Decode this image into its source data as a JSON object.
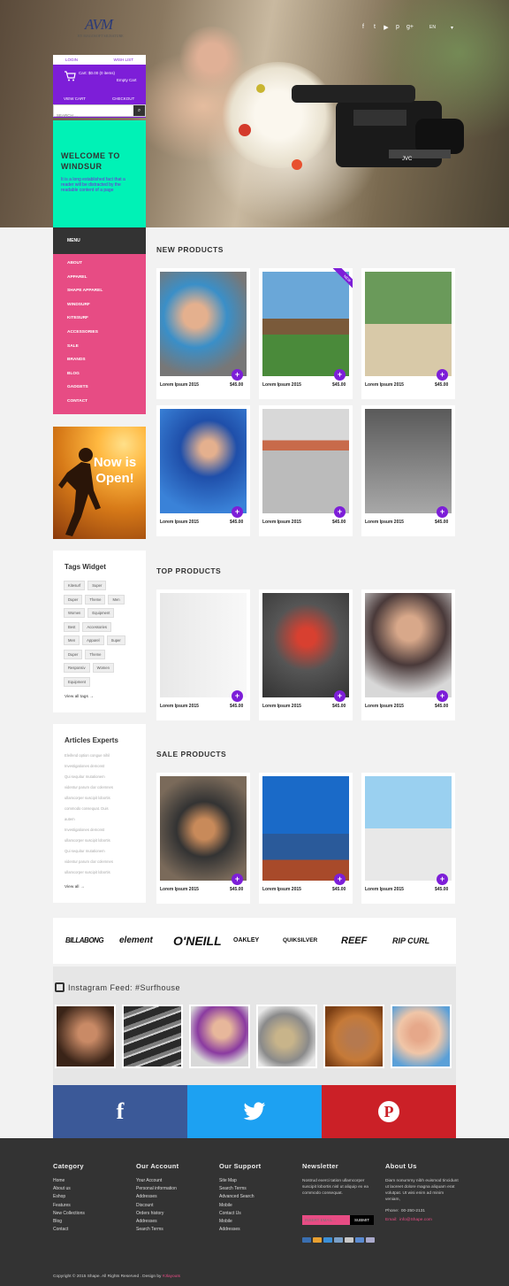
{
  "header": {
    "logo_text": "AVM",
    "logo_sub": "BY MAGOSOFT SIGNATURE",
    "social_icons": [
      "facebook-icon",
      "twitter-icon",
      "youtube-icon",
      "pinterest-icon",
      "google-plus-icon"
    ],
    "social_glyphs": [
      "f",
      "t",
      "▶",
      "p",
      "g+"
    ],
    "language": "EN"
  },
  "account": {
    "login": "LOGIN",
    "wishlist": "WISH LIST",
    "cart_line1": "Cart: $0.00 (0 items)",
    "cart_line2": "Empty Cart",
    "view_cart": "VIEW CART",
    "checkout": "CHECKOUT"
  },
  "search": {
    "placeholder": "SEARCH ..."
  },
  "welcome": {
    "title": "WELCOME TO WINDSUR",
    "text": "It is a long established fact that a reader will be distracted by the readable content of a page"
  },
  "menu": {
    "heading": "MENU",
    "items": [
      "ABOUT",
      "APPAREL",
      "SHAPE APPAREL",
      "WINDSURF",
      "KITESURF",
      "ACCESSORIES",
      "SALE",
      "BRANDS",
      "BLOG",
      "GADGETS",
      "CONTACT"
    ]
  },
  "promo": {
    "text": "Now is Open!"
  },
  "tags_widget": {
    "title": "Tags Widget",
    "rows": [
      [
        "Kitesurf",
        "Super"
      ],
      [
        "Duper",
        "Theme",
        "Men"
      ],
      [
        "Women",
        "Equipment"
      ],
      [
        "Best",
        "Accessories"
      ],
      [
        "Men",
        "Apparel",
        "Super"
      ],
      [
        "Duper",
        "Theme"
      ],
      [
        "Responsiv",
        "Women"
      ],
      [
        "Equipment"
      ]
    ],
    "view_all": "View all tags →"
  },
  "articles_widget": {
    "title": "Articles Experts",
    "lines": [
      "Eleifend option congue nihil",
      "Investigationes demonst",
      "Qui sequitur mutationem",
      "videntur parum clar colemnes",
      "ullamcorper suscipit lobortis",
      "commodo consequat. Duis",
      "autem",
      "Investigationes demonst",
      "ullamcorper suscipit lobortis",
      "Qui sequitur mutationem",
      "videntur parum clar colemnes",
      "ullamcorper suscipit lobortis"
    ],
    "view_all": "View all →"
  },
  "sections": {
    "new": "NEW PRODUCTS",
    "top": "TOP PRODUCTS",
    "sale": "SALE PRODUCTS"
  },
  "product": {
    "name": "Lorem Ipsum 2015",
    "price": "$45.00",
    "badge": "NEW"
  },
  "brands": [
    "BILLABONG",
    "element",
    "O'NEILL",
    "OAKLEY",
    "QUIKSILVER",
    "REEF",
    "RIP CURL"
  ],
  "instagram": {
    "title": "Instagram Feed: #Surfhouse"
  },
  "social_banners": [
    "f",
    "twitter",
    "P"
  ],
  "footer": {
    "category": {
      "title": "Category",
      "links": [
        "Home",
        "About us",
        "Eshop",
        "Features",
        "New Collections",
        "Blog",
        "Contact"
      ]
    },
    "account": {
      "title": "Our Account",
      "links": [
        "Your Account",
        "Personal information",
        "Addresses",
        "Discount",
        "Orders history",
        "Addresses",
        "Search Terms"
      ]
    },
    "support": {
      "title": "Our Support",
      "links": [
        "Site Map",
        "Search Terms",
        "Advanced Search",
        "Mobile",
        "Contact Us",
        "Mobile",
        "Addresses"
      ]
    },
    "newsletter": {
      "title": "Newsletter",
      "text": "Nostrud exerci tation ullamcorper suscipit lobortis nisl ut aliquip ex ea commodo consequat.",
      "placeholder": "INSERT EMAIL...",
      "button": "SUBMIT"
    },
    "about": {
      "title": "About Us",
      "text": "Diam nonummy nibh euismod tincidunt ut laoreet dolore magna aliquam erat volutpat. Ut wisi enim ad minim veniam,",
      "phone_label": "Phone:",
      "phone": "00-250-2131",
      "email_label": "Email:",
      "email": "info@Shape.com"
    },
    "copyright": "Copyright © 2015 Shape. All Rights Reserved . Design by",
    "designer": "#Jlayouts"
  },
  "colors": {
    "accent_purple": "#7d1ed8",
    "pink": "#e74c84",
    "mint": "#00f2b6",
    "dark": "#333333"
  }
}
